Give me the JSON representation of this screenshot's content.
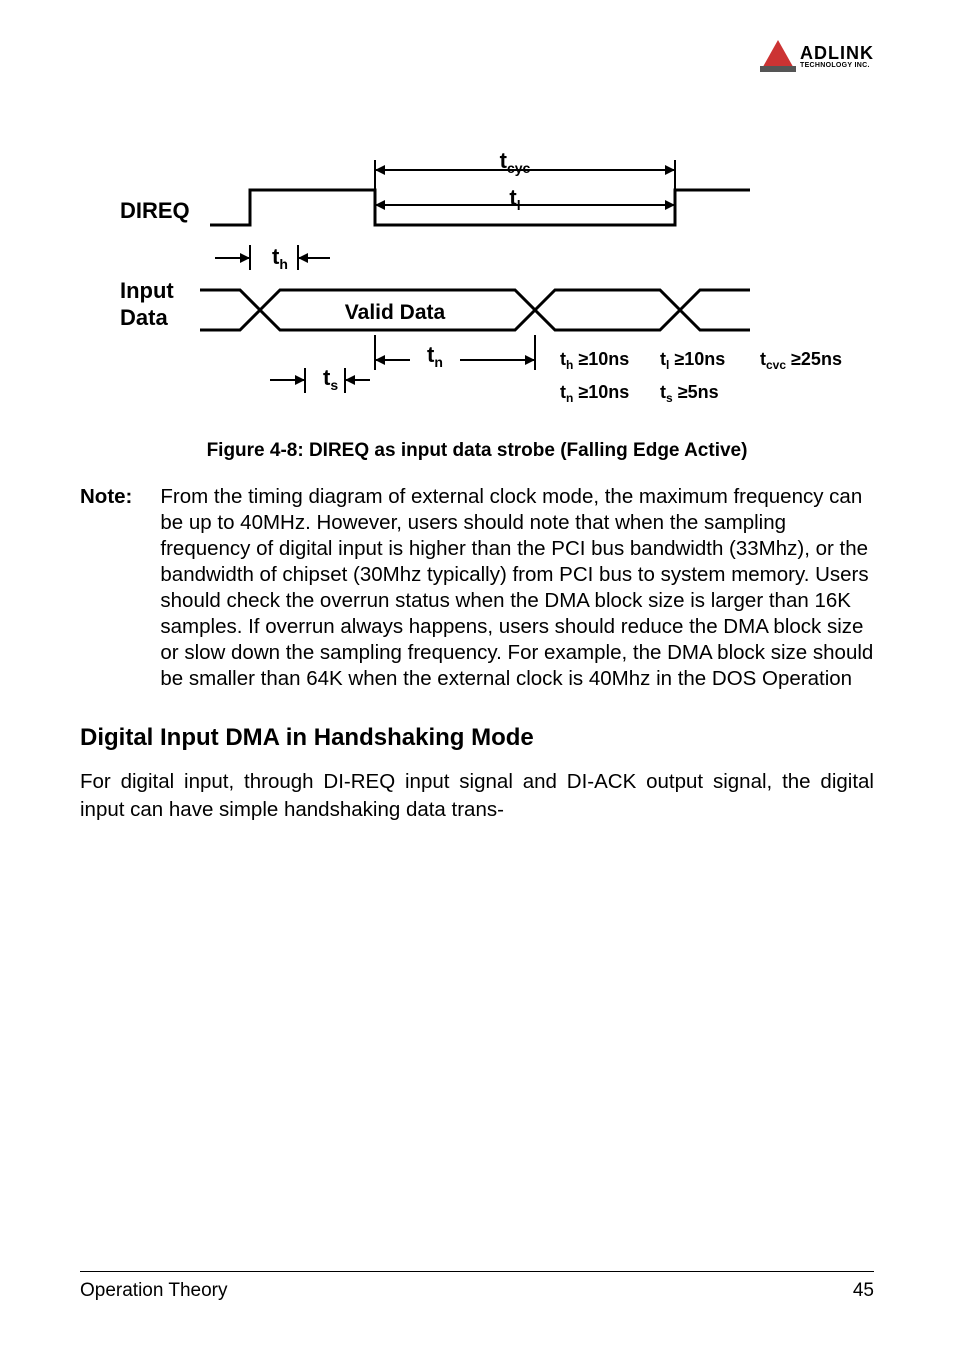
{
  "logo": {
    "main": "ADLINK",
    "sub": "TECHNOLOGY INC."
  },
  "diagram": {
    "labels": {
      "direq": "DIREQ",
      "input": "Input",
      "data": "Data",
      "valid": "Valid Data",
      "tcyc": "t",
      "tcyc_sub": "cyc",
      "tl": "t",
      "tl_sub": "l",
      "th": "t",
      "th_sub": "h",
      "tn": "t",
      "tn_sub": "n",
      "ts": "t",
      "ts_sub": "s"
    },
    "constraints": {
      "th_lbl": "t",
      "th_sub": "h",
      "th_val": "≥10ns",
      "tl_lbl": "t",
      "tl_sub": "l",
      "tl_val": "≥10ns",
      "tcyc_lbl": "t",
      "tcyc_sub": "cvc",
      "tcyc_val": "≥25ns",
      "tn_lbl": "t",
      "tn_sub": "n",
      "tn_val": "≥10ns",
      "ts_lbl": "t",
      "ts_sub": "s",
      "ts_val": "≥5ns"
    }
  },
  "caption": "Figure 4-8: DIREQ as input data strobe (Falling Edge Active)",
  "note": {
    "label": "Note:",
    "text": "From the timing diagram of external clock mode, the maximum frequency can be up to 40MHz. However, users should note that when the sampling frequency of digital input is higher than the PCI bus bandwidth (33Mhz), or the bandwidth of chipset (30Mhz typically) from PCI bus to system memory. Users should check the overrun status when the DMA block size is larger than 16K samples. If overrun always happens, users should reduce the DMA block size or slow down the sampling frequency. For example, the DMA block size should be smaller than 64K when the external clock is 40Mhz in the DOS Operation"
  },
  "section_heading": "Digital Input DMA in Handshaking Mode",
  "body_text": "For digital input, through DI-REQ input signal and DI-ACK output signal, the digital input can have simple handshaking data trans-",
  "footer": {
    "left": "Operation Theory",
    "right": "45"
  }
}
